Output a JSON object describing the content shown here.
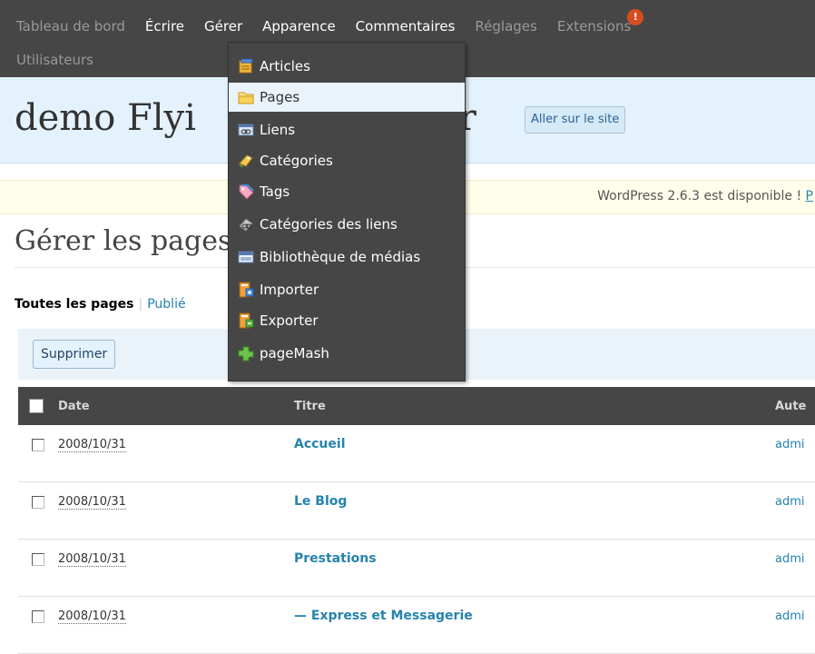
{
  "topnav": {
    "row1": [
      "Tableau de bord",
      "Écrire",
      "Gérer",
      "Apparence",
      "Commentaires",
      "Réglages",
      "Extensions"
    ],
    "row2": [
      "Utilisateurs"
    ],
    "badge": "!"
  },
  "header": {
    "site_title": "demo Flyi",
    "site_title_tail": "ter",
    "visit_site": "Aller sur le site"
  },
  "notice": {
    "text": "WordPress 2.6.3 est disponible ! ",
    "link": "P"
  },
  "page": {
    "title": "Gérer les pages",
    "filters": {
      "all": "Toutes les pages",
      "sep": "|",
      "published": "Publié"
    },
    "delete_button": "Supprimer"
  },
  "table": {
    "headers": {
      "date": "Date",
      "title": "Titre",
      "author": "Aute"
    },
    "rows": [
      {
        "date": "2008/10/31",
        "title": "Accueil",
        "author": "admi"
      },
      {
        "date": "2008/10/31",
        "title": "Le Blog",
        "author": "admi"
      },
      {
        "date": "2008/10/31",
        "title": "Prestations",
        "author": "admi"
      },
      {
        "date": "2008/10/31",
        "title": "— Express et Messagerie",
        "author": "admi"
      }
    ]
  },
  "dropdown": {
    "items": [
      {
        "label": "Articles",
        "icon": "articles-icon"
      },
      {
        "label": "Pages",
        "icon": "pages-icon"
      },
      {
        "label": "Liens",
        "icon": "links-icon"
      },
      {
        "label": "Catégories",
        "icon": "categories-icon"
      },
      {
        "label": "Tags",
        "icon": "tags-icon"
      },
      {
        "label": "Catégories des liens",
        "icon": "link-categories-icon"
      },
      {
        "label": "Bibliothèque de médias",
        "icon": "media-library-icon"
      },
      {
        "label": "Importer",
        "icon": "import-icon"
      },
      {
        "label": "Exporter",
        "icon": "export-icon"
      },
      {
        "label": "pageMash",
        "icon": "pagemash-icon"
      }
    ],
    "active": "Pages"
  },
  "colors": {
    "adminbar": "#464646",
    "header_bg": "#e4f2fd",
    "link": "#2583ad",
    "notice_bg": "#fffeeb",
    "badge": "#d54e21"
  }
}
